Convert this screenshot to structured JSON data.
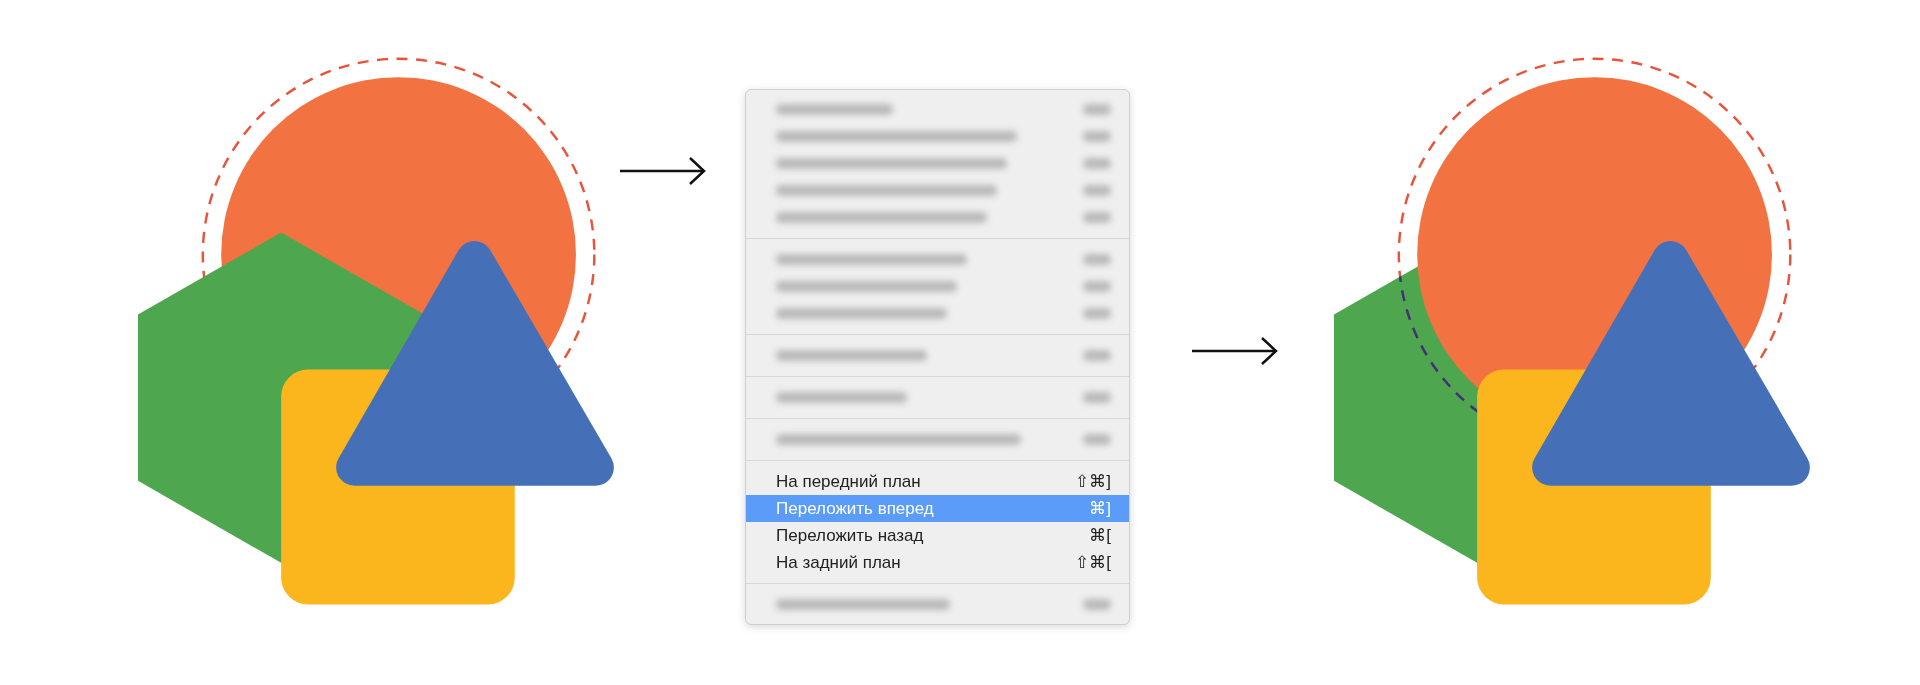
{
  "menu": {
    "items": [
      {
        "kind": "blurred"
      },
      {
        "kind": "blurred"
      },
      {
        "kind": "blurred"
      },
      {
        "kind": "blurred"
      },
      {
        "kind": "blurred"
      },
      {
        "kind": "separator"
      },
      {
        "kind": "blurred"
      },
      {
        "kind": "blurred"
      },
      {
        "kind": "blurred"
      },
      {
        "kind": "separator"
      },
      {
        "kind": "blurred"
      },
      {
        "kind": "separator"
      },
      {
        "kind": "blurred"
      },
      {
        "kind": "separator"
      },
      {
        "kind": "blurred"
      },
      {
        "kind": "separator"
      },
      {
        "kind": "item",
        "label": "На передний план",
        "shortcut": "⇧⌘]",
        "selected": false
      },
      {
        "kind": "item",
        "label": "Переложить вперед",
        "shortcut": "⌘]",
        "selected": true
      },
      {
        "kind": "item",
        "label": "Переложить назад",
        "shortcut": "⌘[",
        "selected": false
      },
      {
        "kind": "item",
        "label": "На задний план",
        "shortcut": "⇧⌘[",
        "selected": false
      },
      {
        "kind": "separator"
      },
      {
        "kind": "blurred"
      }
    ]
  }
}
